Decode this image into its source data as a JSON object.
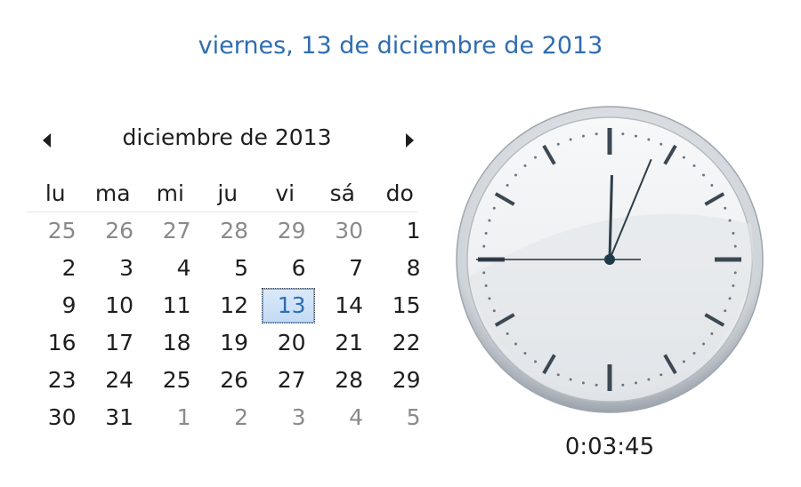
{
  "header": {
    "full_date": "viernes, 13 de diciembre de 2013"
  },
  "calendar": {
    "month_title": "diciembre de 2013",
    "weekdays": [
      "lu",
      "ma",
      "mi",
      "ju",
      "vi",
      "sá",
      "do"
    ],
    "weeks": [
      [
        {
          "d": "25",
          "o": true
        },
        {
          "d": "26",
          "o": true
        },
        {
          "d": "27",
          "o": true
        },
        {
          "d": "28",
          "o": true
        },
        {
          "d": "29",
          "o": true
        },
        {
          "d": "30",
          "o": true
        },
        {
          "d": "1"
        }
      ],
      [
        {
          "d": "2"
        },
        {
          "d": "3"
        },
        {
          "d": "4"
        },
        {
          "d": "5"
        },
        {
          "d": "6"
        },
        {
          "d": "7"
        },
        {
          "d": "8"
        }
      ],
      [
        {
          "d": "9"
        },
        {
          "d": "10"
        },
        {
          "d": "11"
        },
        {
          "d": "12"
        },
        {
          "d": "13",
          "today": true
        },
        {
          "d": "14"
        },
        {
          "d": "15"
        }
      ],
      [
        {
          "d": "16"
        },
        {
          "d": "17"
        },
        {
          "d": "18"
        },
        {
          "d": "19"
        },
        {
          "d": "20"
        },
        {
          "d": "21"
        },
        {
          "d": "22"
        }
      ],
      [
        {
          "d": "23"
        },
        {
          "d": "24"
        },
        {
          "d": "25"
        },
        {
          "d": "26"
        },
        {
          "d": "27"
        },
        {
          "d": "28"
        },
        {
          "d": "29"
        }
      ],
      [
        {
          "d": "30"
        },
        {
          "d": "31"
        },
        {
          "d": "1",
          "o": true
        },
        {
          "d": "2",
          "o": true
        },
        {
          "d": "3",
          "o": true
        },
        {
          "d": "4",
          "o": true
        },
        {
          "d": "5",
          "o": true
        }
      ]
    ],
    "prev_icon": "triangle-left-icon",
    "next_icon": "triangle-right-icon"
  },
  "clock": {
    "hours": 0,
    "minutes": 3,
    "seconds": 45,
    "digital": "0:03:45",
    "colors": {
      "face": "#f2f4f6",
      "rim": "#c9ced3",
      "marks": "#3c4852",
      "hands": "#2e3d47"
    }
  }
}
